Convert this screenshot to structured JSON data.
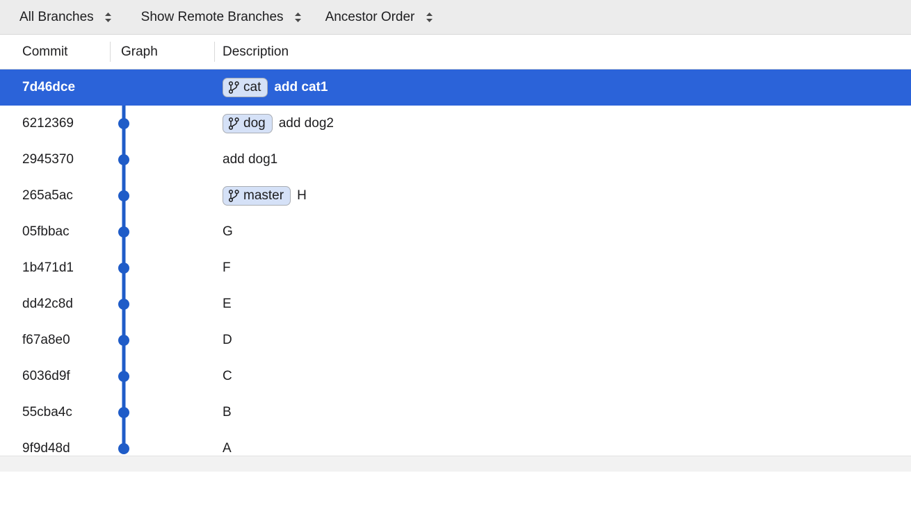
{
  "toolbar": {
    "controls": [
      {
        "label": "All Branches",
        "icon": "updown-chevron-icon"
      },
      {
        "label": "Show Remote Branches",
        "icon": "updown-chevron-icon"
      },
      {
        "label": "Ancestor Order",
        "icon": "updown-chevron-icon"
      }
    ]
  },
  "columns": {
    "commit": "Commit",
    "graph": "Graph",
    "description": "Description"
  },
  "colors": {
    "selection_blue": "#2b63d9",
    "graph_line": "#1f5cc8",
    "badge_fill": "#d5e1f7",
    "badge_border": "#a9adb3",
    "toolbar_bg": "#ececec"
  },
  "commits": [
    {
      "hash": "7d46dce",
      "badge": "cat",
      "description": "add cat1",
      "selected": true,
      "head": true
    },
    {
      "hash": "6212369",
      "badge": "dog",
      "description": "add dog2",
      "selected": false,
      "head": false
    },
    {
      "hash": "2945370",
      "badge": null,
      "description": "add dog1",
      "selected": false,
      "head": false
    },
    {
      "hash": "265a5ac",
      "badge": "master",
      "description": "H",
      "selected": false,
      "head": false
    },
    {
      "hash": "05fbbac",
      "badge": null,
      "description": "G",
      "selected": false,
      "head": false
    },
    {
      "hash": "1b471d1",
      "badge": null,
      "description": "F",
      "selected": false,
      "head": false
    },
    {
      "hash": "dd42c8d",
      "badge": null,
      "description": "E",
      "selected": false,
      "head": false
    },
    {
      "hash": "f67a8e0",
      "badge": null,
      "description": "D",
      "selected": false,
      "head": false
    },
    {
      "hash": "6036d9f",
      "badge": null,
      "description": "C",
      "selected": false,
      "head": false
    },
    {
      "hash": "55cba4c",
      "badge": null,
      "description": "B",
      "selected": false,
      "head": false
    },
    {
      "hash": "9f9d48d",
      "badge": null,
      "description": "A",
      "selected": false,
      "head": false
    }
  ]
}
